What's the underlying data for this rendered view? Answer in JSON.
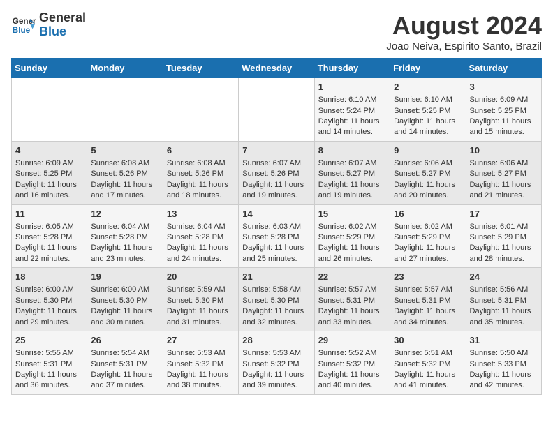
{
  "header": {
    "logo_line1": "General",
    "logo_line2": "Blue",
    "month_title": "August 2024",
    "location": "Joao Neiva, Espirito Santo, Brazil"
  },
  "days_of_week": [
    "Sunday",
    "Monday",
    "Tuesday",
    "Wednesday",
    "Thursday",
    "Friday",
    "Saturday"
  ],
  "weeks": [
    [
      {
        "day": "",
        "info": ""
      },
      {
        "day": "",
        "info": ""
      },
      {
        "day": "",
        "info": ""
      },
      {
        "day": "",
        "info": ""
      },
      {
        "day": "1",
        "info": "Sunrise: 6:10 AM\nSunset: 5:24 PM\nDaylight: 11 hours\nand 14 minutes."
      },
      {
        "day": "2",
        "info": "Sunrise: 6:10 AM\nSunset: 5:25 PM\nDaylight: 11 hours\nand 14 minutes."
      },
      {
        "day": "3",
        "info": "Sunrise: 6:09 AM\nSunset: 5:25 PM\nDaylight: 11 hours\nand 15 minutes."
      }
    ],
    [
      {
        "day": "4",
        "info": "Sunrise: 6:09 AM\nSunset: 5:25 PM\nDaylight: 11 hours\nand 16 minutes."
      },
      {
        "day": "5",
        "info": "Sunrise: 6:08 AM\nSunset: 5:26 PM\nDaylight: 11 hours\nand 17 minutes."
      },
      {
        "day": "6",
        "info": "Sunrise: 6:08 AM\nSunset: 5:26 PM\nDaylight: 11 hours\nand 18 minutes."
      },
      {
        "day": "7",
        "info": "Sunrise: 6:07 AM\nSunset: 5:26 PM\nDaylight: 11 hours\nand 19 minutes."
      },
      {
        "day": "8",
        "info": "Sunrise: 6:07 AM\nSunset: 5:27 PM\nDaylight: 11 hours\nand 19 minutes."
      },
      {
        "day": "9",
        "info": "Sunrise: 6:06 AM\nSunset: 5:27 PM\nDaylight: 11 hours\nand 20 minutes."
      },
      {
        "day": "10",
        "info": "Sunrise: 6:06 AM\nSunset: 5:27 PM\nDaylight: 11 hours\nand 21 minutes."
      }
    ],
    [
      {
        "day": "11",
        "info": "Sunrise: 6:05 AM\nSunset: 5:28 PM\nDaylight: 11 hours\nand 22 minutes."
      },
      {
        "day": "12",
        "info": "Sunrise: 6:04 AM\nSunset: 5:28 PM\nDaylight: 11 hours\nand 23 minutes."
      },
      {
        "day": "13",
        "info": "Sunrise: 6:04 AM\nSunset: 5:28 PM\nDaylight: 11 hours\nand 24 minutes."
      },
      {
        "day": "14",
        "info": "Sunrise: 6:03 AM\nSunset: 5:28 PM\nDaylight: 11 hours\nand 25 minutes."
      },
      {
        "day": "15",
        "info": "Sunrise: 6:02 AM\nSunset: 5:29 PM\nDaylight: 11 hours\nand 26 minutes."
      },
      {
        "day": "16",
        "info": "Sunrise: 6:02 AM\nSunset: 5:29 PM\nDaylight: 11 hours\nand 27 minutes."
      },
      {
        "day": "17",
        "info": "Sunrise: 6:01 AM\nSunset: 5:29 PM\nDaylight: 11 hours\nand 28 minutes."
      }
    ],
    [
      {
        "day": "18",
        "info": "Sunrise: 6:00 AM\nSunset: 5:30 PM\nDaylight: 11 hours\nand 29 minutes."
      },
      {
        "day": "19",
        "info": "Sunrise: 6:00 AM\nSunset: 5:30 PM\nDaylight: 11 hours\nand 30 minutes."
      },
      {
        "day": "20",
        "info": "Sunrise: 5:59 AM\nSunset: 5:30 PM\nDaylight: 11 hours\nand 31 minutes."
      },
      {
        "day": "21",
        "info": "Sunrise: 5:58 AM\nSunset: 5:30 PM\nDaylight: 11 hours\nand 32 minutes."
      },
      {
        "day": "22",
        "info": "Sunrise: 5:57 AM\nSunset: 5:31 PM\nDaylight: 11 hours\nand 33 minutes."
      },
      {
        "day": "23",
        "info": "Sunrise: 5:57 AM\nSunset: 5:31 PM\nDaylight: 11 hours\nand 34 minutes."
      },
      {
        "day": "24",
        "info": "Sunrise: 5:56 AM\nSunset: 5:31 PM\nDaylight: 11 hours\nand 35 minutes."
      }
    ],
    [
      {
        "day": "25",
        "info": "Sunrise: 5:55 AM\nSunset: 5:31 PM\nDaylight: 11 hours\nand 36 minutes."
      },
      {
        "day": "26",
        "info": "Sunrise: 5:54 AM\nSunset: 5:31 PM\nDaylight: 11 hours\nand 37 minutes."
      },
      {
        "day": "27",
        "info": "Sunrise: 5:53 AM\nSunset: 5:32 PM\nDaylight: 11 hours\nand 38 minutes."
      },
      {
        "day": "28",
        "info": "Sunrise: 5:53 AM\nSunset: 5:32 PM\nDaylight: 11 hours\nand 39 minutes."
      },
      {
        "day": "29",
        "info": "Sunrise: 5:52 AM\nSunset: 5:32 PM\nDaylight: 11 hours\nand 40 minutes."
      },
      {
        "day": "30",
        "info": "Sunrise: 5:51 AM\nSunset: 5:32 PM\nDaylight: 11 hours\nand 41 minutes."
      },
      {
        "day": "31",
        "info": "Sunrise: 5:50 AM\nSunset: 5:33 PM\nDaylight: 11 hours\nand 42 minutes."
      }
    ]
  ]
}
